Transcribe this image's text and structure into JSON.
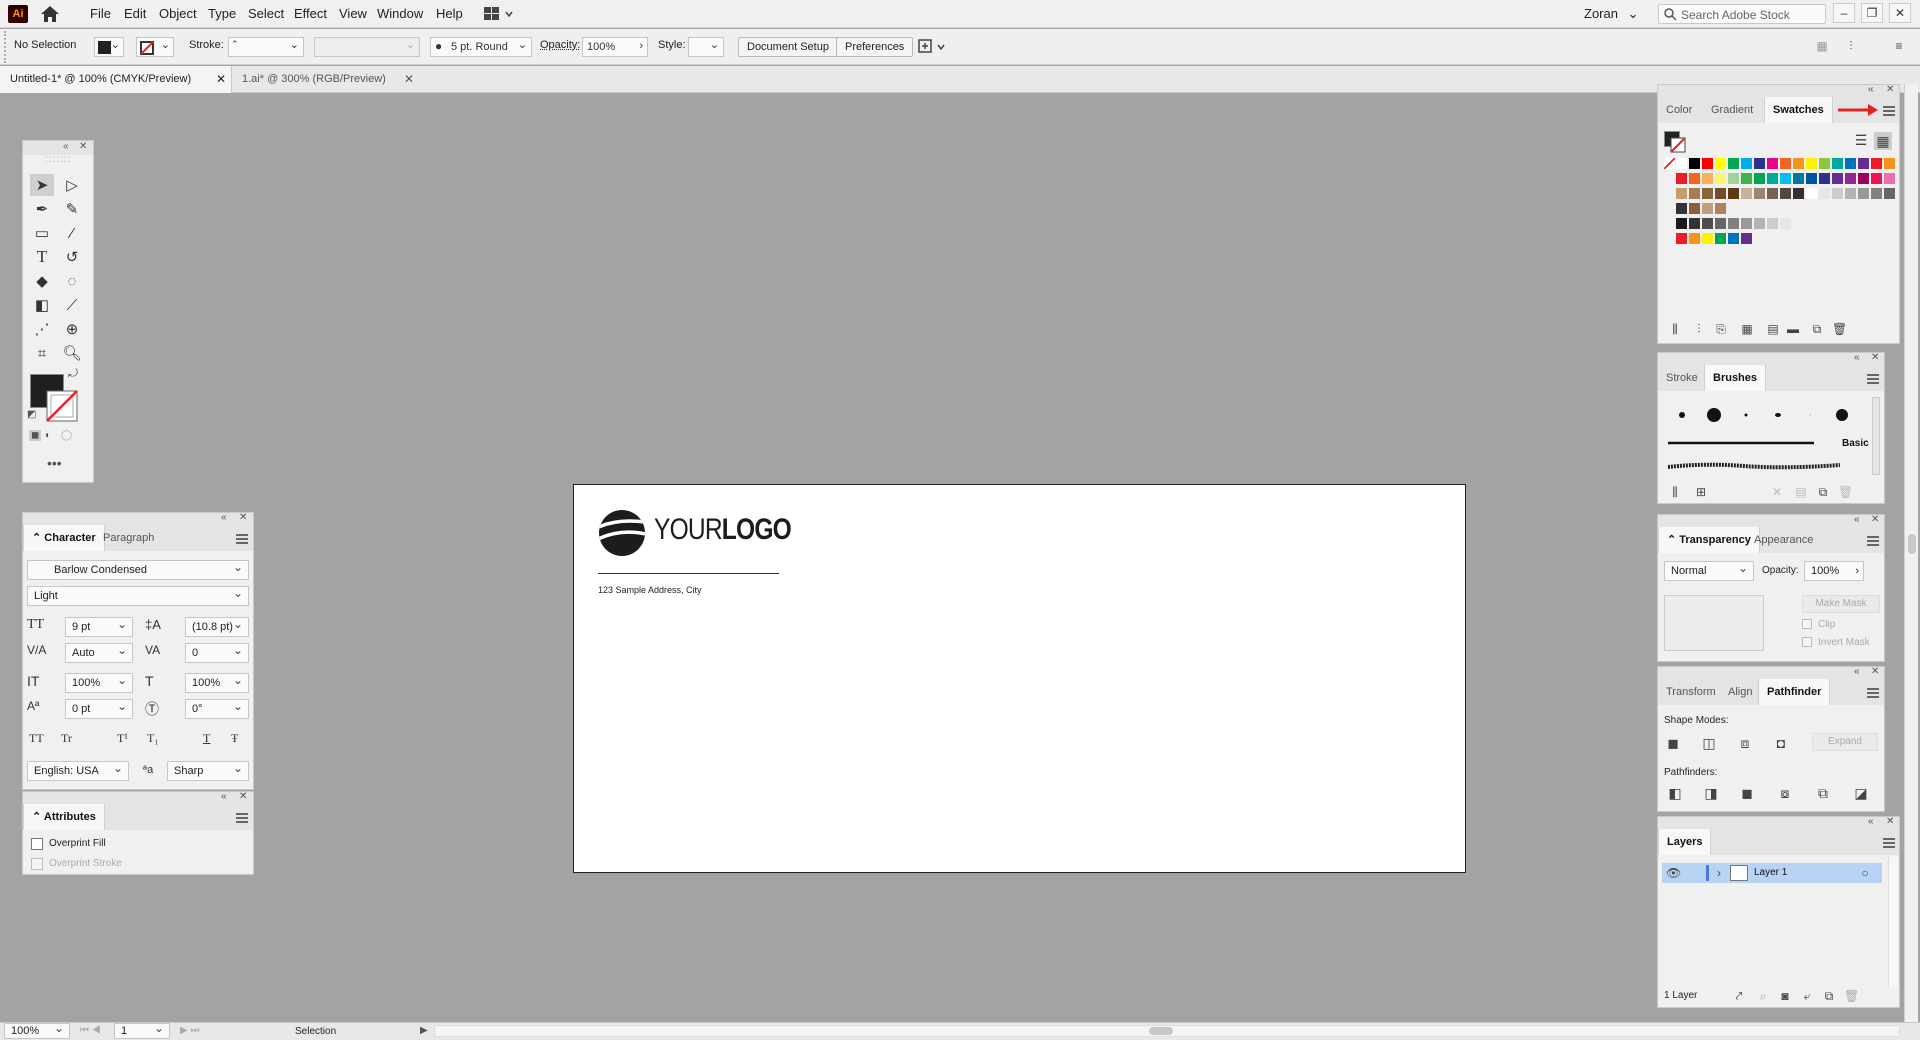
{
  "app": {
    "logo": "Ai"
  },
  "menu": [
    "File",
    "Edit",
    "Object",
    "Type",
    "Select",
    "Effect",
    "View",
    "Window",
    "Help"
  ],
  "user": "Zoran",
  "search": {
    "placeholder": "Search Adobe Stock"
  },
  "window_buttons": {
    "minimize": "–",
    "restore": "❐",
    "close": "✕"
  },
  "control": {
    "selection": "No Selection",
    "stroke_label": "Stroke:",
    "brush": "5 pt. Round",
    "opacity_label": "Opacity:",
    "opacity": "100%",
    "style_label": "Style:",
    "document_setup": "Document Setup",
    "preferences": "Preferences"
  },
  "tabs": [
    {
      "label": "Untitled-1* @ 100% (CMYK/Preview)",
      "close": "✕"
    },
    {
      "label": "1.ai* @ 300% (RGB/Preview)",
      "close": "✕"
    }
  ],
  "character": {
    "tabs": [
      "Character",
      "Paragraph"
    ],
    "font": "Barlow Condensed",
    "style": "Light",
    "size": "9 pt",
    "leading": "(10.8 pt)",
    "kerning": "Auto",
    "tracking": "0",
    "vscale": "100%",
    "hscale": "100%",
    "baseline": "0 pt",
    "rotation": "0°",
    "language": "English: USA",
    "antialias": "Sharp",
    "aa_icon": "ªa",
    "glyphs": [
      "TT",
      "Tr",
      "T¹",
      "T₁",
      "T",
      "Ŧ"
    ]
  },
  "attributes": {
    "title": "Attributes",
    "overprint_fill": "Overprint Fill",
    "overprint_stroke": "Overprint Stroke"
  },
  "swatches_panel": {
    "tabs": [
      "Color",
      "Gradient",
      "Swatches"
    ]
  },
  "brushes_panel": {
    "tabs": [
      "Stroke",
      "Brushes"
    ],
    "basic": "Basic"
  },
  "transparency_panel": {
    "tabs": [
      "Transparency",
      "Appearance"
    ],
    "mode": "Normal",
    "opacity_label": "Opacity:",
    "opacity": "100%",
    "make_mask": "Make Mask",
    "clip": "Clip",
    "invert_mask": "Invert Mask"
  },
  "pathfinder_panel": {
    "tabs": [
      "Transform",
      "Align",
      "Pathfinder"
    ],
    "shape_modes": "Shape Modes:",
    "pathfinders": "Pathfinders:",
    "expand": "Expand"
  },
  "layers_panel": {
    "title": "Layers",
    "layer_name": "Layer 1",
    "count": "1 Layer"
  },
  "artboard": {
    "logo_light": "YOUR",
    "logo_bold": "LOGO",
    "address": "123 Sample Address, City"
  },
  "status": {
    "zoom": "100%",
    "page": "1",
    "mode": "Selection"
  },
  "colors": {
    "accent_arrow": "#e02424",
    "layer_highlight": "#b7d4f5",
    "layer_color": "#4b7bd8"
  }
}
